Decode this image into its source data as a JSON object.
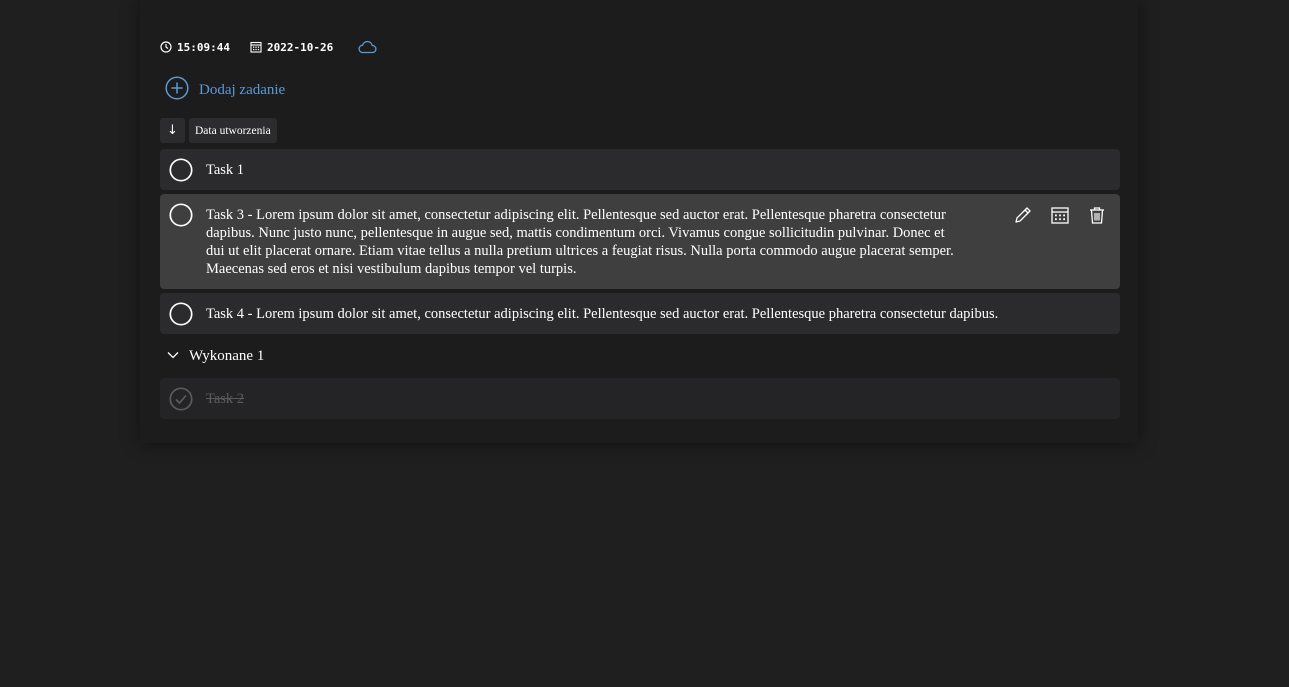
{
  "status": {
    "time": "15:09:44",
    "date": "2022-10-26",
    "icons": [
      "clock-icon",
      "calendar-icon",
      "cloud-icon"
    ]
  },
  "add_task": {
    "label": "Dodaj zadanie",
    "color": "#5a9ad6"
  },
  "sort": {
    "direction_glyph": "↓",
    "field": "Data utworzenia"
  },
  "tasks": [
    {
      "title": "Task 1",
      "completed": false
    },
    {
      "title": "Task 3 - Lorem ipsum dolor sit amet, consectetur adipiscing elit. Pellentesque sed auctor erat. Pellentesque pharetra consectetur dapibus. Nunc justo nunc, pellentesque in augue sed, mattis condimentum orci. Vivamus congue sollicitudin pulvinar. Donec et dui ut elit placerat ornare. Etiam vitae tellus a nulla pretium ultrices a feugiat risus. Nulla porta commodo augue placerat semper. Maecenas sed eros et nisi vestibulum dapibus tempor vel turpis.",
      "completed": false,
      "actions": [
        "pencil-icon",
        "calendar-icon",
        "trash-icon"
      ]
    },
    {
      "title": "Task 4 - Lorem ipsum dolor sit amet, consectetur adipiscing elit. Pellentesque sed auctor erat. Pellentesque pharetra consectetur dapibus.",
      "completed": false
    }
  ],
  "completed_section": {
    "label": "Wykonane 1",
    "expanded": true,
    "tasks": [
      {
        "title": "Task 2",
        "completed": true
      }
    ]
  }
}
